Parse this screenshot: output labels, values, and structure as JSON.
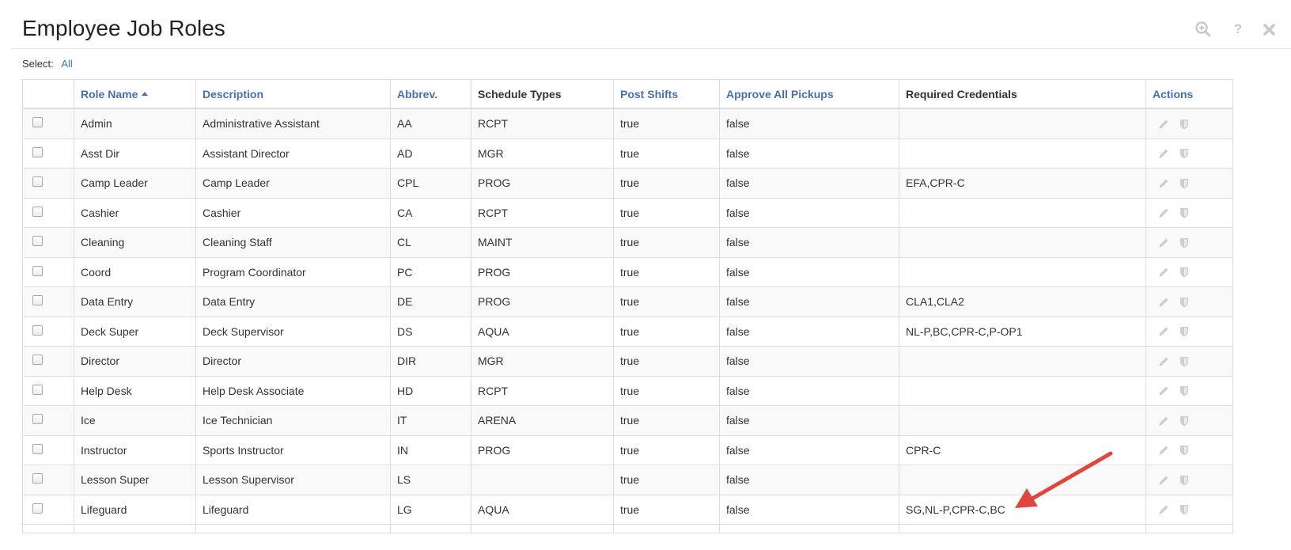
{
  "page": {
    "title": "Employee Job Roles"
  },
  "toolbar": {
    "icons": [
      "zoom-in-icon",
      "help-icon",
      "close-icon"
    ],
    "help_glyph": "?",
    "icon_color": "#c8c8c8"
  },
  "select": {
    "label": "Select:",
    "all_label": "All"
  },
  "table": {
    "headers": {
      "role_name": "Role Name",
      "description": "Description",
      "abbrev": "Abbrev.",
      "schedule_types": "Schedule Types",
      "post_shifts": "Post Shifts",
      "approve_all_pickups": "Approve All Pickups",
      "required_credentials": "Required Credentials",
      "actions": "Actions"
    },
    "sorted_column": "Role Name",
    "sort_direction": "ascending",
    "rows": [
      {
        "role_name": "Admin",
        "description": "Administrative Assistant",
        "abbrev": "AA",
        "schedule_types": "RCPT",
        "post_shifts": "true",
        "approve_all_pickups": "false",
        "required_credentials": ""
      },
      {
        "role_name": "Asst Dir",
        "description": "Assistant Director",
        "abbrev": "AD",
        "schedule_types": "MGR",
        "post_shifts": "true",
        "approve_all_pickups": "false",
        "required_credentials": ""
      },
      {
        "role_name": "Camp Leader",
        "description": "Camp Leader",
        "abbrev": "CPL",
        "schedule_types": "PROG",
        "post_shifts": "true",
        "approve_all_pickups": "false",
        "required_credentials": "EFA,CPR-C"
      },
      {
        "role_name": "Cashier",
        "description": "Cashier",
        "abbrev": "CA",
        "schedule_types": "RCPT",
        "post_shifts": "true",
        "approve_all_pickups": "false",
        "required_credentials": ""
      },
      {
        "role_name": "Cleaning",
        "description": "Cleaning Staff",
        "abbrev": "CL",
        "schedule_types": "MAINT",
        "post_shifts": "true",
        "approve_all_pickups": "false",
        "required_credentials": ""
      },
      {
        "role_name": "Coord",
        "description": "Program Coordinator",
        "abbrev": "PC",
        "schedule_types": "PROG",
        "post_shifts": "true",
        "approve_all_pickups": "false",
        "required_credentials": ""
      },
      {
        "role_name": "Data Entry",
        "description": "Data Entry",
        "abbrev": "DE",
        "schedule_types": "PROG",
        "post_shifts": "true",
        "approve_all_pickups": "false",
        "required_credentials": "CLA1,CLA2"
      },
      {
        "role_name": "Deck Super",
        "description": "Deck Supervisor",
        "abbrev": "DS",
        "schedule_types": "AQUA",
        "post_shifts": "true",
        "approve_all_pickups": "false",
        "required_credentials": "NL-P,BC,CPR-C,P-OP1"
      },
      {
        "role_name": "Director",
        "description": "Director",
        "abbrev": "DIR",
        "schedule_types": "MGR",
        "post_shifts": "true",
        "approve_all_pickups": "false",
        "required_credentials": ""
      },
      {
        "role_name": "Help Desk",
        "description": "Help Desk Associate",
        "abbrev": "HD",
        "schedule_types": "RCPT",
        "post_shifts": "true",
        "approve_all_pickups": "false",
        "required_credentials": ""
      },
      {
        "role_name": "Ice",
        "description": "Ice Technician",
        "abbrev": "IT",
        "schedule_types": "ARENA",
        "post_shifts": "true",
        "approve_all_pickups": "false",
        "required_credentials": ""
      },
      {
        "role_name": "Instructor",
        "description": "Sports Instructor",
        "abbrev": "IN",
        "schedule_types": "PROG",
        "post_shifts": "true",
        "approve_all_pickups": "false",
        "required_credentials": "CPR-C"
      },
      {
        "role_name": "Lesson Super",
        "description": "Lesson Supervisor",
        "abbrev": "LS",
        "schedule_types": "",
        "post_shifts": "true",
        "approve_all_pickups": "false",
        "required_credentials": ""
      },
      {
        "role_name": "Lifeguard",
        "description": "Lifeguard",
        "abbrev": "LG",
        "schedule_types": "AQUA",
        "post_shifts": "true",
        "approve_all_pickups": "false",
        "required_credentials": "SG,NL-P,CPR-C,BC"
      }
    ],
    "row_actions": [
      "edit-icon",
      "shield-icon"
    ]
  },
  "annotation": {
    "arrow_color": "#e0473c"
  }
}
